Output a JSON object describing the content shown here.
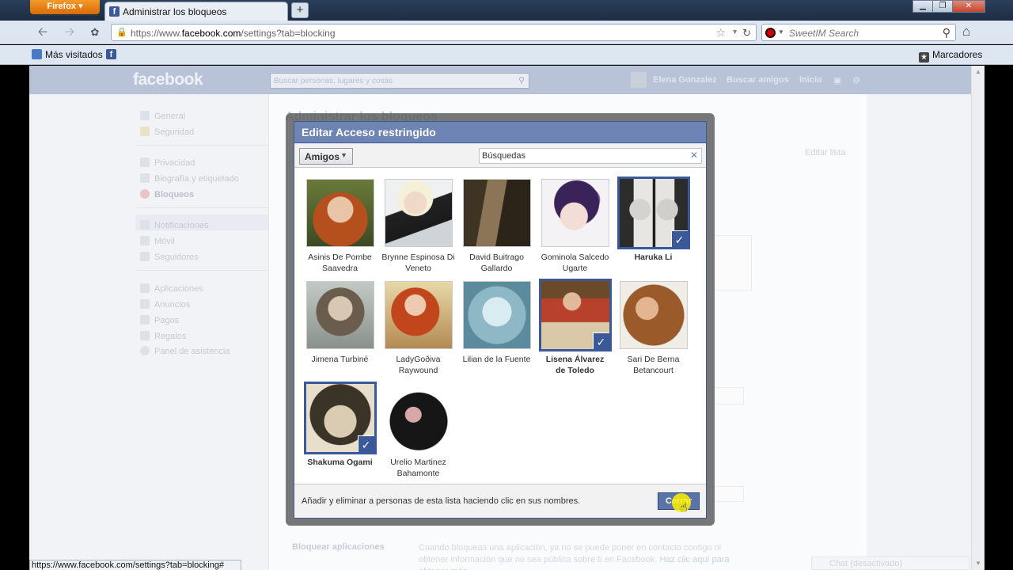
{
  "browser": {
    "menu_button": "Firefox",
    "tab_title": "Administrar los bloqueos",
    "new_tab": "+",
    "url_prefix": "https://www.",
    "url_domain": "facebook.com",
    "url_path": "/settings?tab=blocking",
    "search_placeholder": "SweetIM Search",
    "bookmarks_left": "Más visitados",
    "bookmarks_right": "Marcadores",
    "status_url": "https://www.facebook.com/settings?tab=blocking#"
  },
  "fb": {
    "logo": "facebook",
    "search_placeholder": "Buscar personas, lugares y cosas",
    "user_name": "Elena Gonzalez",
    "find_friends": "Buscar amigos",
    "home": "Inicio",
    "ghost_title": "Administrar los bloqueos",
    "ghost_edit": "Editar lista",
    "ghost_block_apps": "Bloquear aplicaciones",
    "ghost_block_apps_text": "Cuando bloqueas una aplicación, ya no se puede poner en contacto contigo ni obtener información que no sea pública sobre ti en Facebook.",
    "ghost_more": "Haz clic aquí para obtener más",
    "chat": "Chat (desactivado)"
  },
  "sidebar": {
    "items": [
      {
        "label": "General"
      },
      {
        "label": "Seguridad"
      },
      {
        "label": "Privacidad"
      },
      {
        "label": "Biografía y etiquetado"
      },
      {
        "label": "Bloqueos"
      },
      {
        "label": "Notificaciones"
      },
      {
        "label": "Móvil"
      },
      {
        "label": "Seguidores"
      },
      {
        "label": "Aplicaciones"
      },
      {
        "label": "Anuncios"
      },
      {
        "label": "Pagos"
      },
      {
        "label": "Regalos"
      },
      {
        "label": "Panel de asistencia"
      }
    ]
  },
  "dialog": {
    "title": "Editar Acceso restringido",
    "filter_label": "Amigos",
    "search_value": "Búsquedas",
    "footer_text": "Añadir y eliminar a personas de esta lista haciendo clic en sus nombres.",
    "close_label": "Cerrar",
    "friends": [
      {
        "line1": "Asinis De Pombe",
        "line2": "Saavedra",
        "selected": false
      },
      {
        "line1": "Brynne Espinosa Di",
        "line2": "Veneto",
        "selected": false
      },
      {
        "line1": "David Buitrago",
        "line2": "Gallardo",
        "selected": false
      },
      {
        "line1": "Gominola Salcedo",
        "line2": "Ugarte",
        "selected": false
      },
      {
        "line1": "Haruka Li",
        "line2": "",
        "selected": true
      },
      {
        "line1": "Jimena Turbiné",
        "line2": "",
        "selected": false
      },
      {
        "line1": "LadyGoðiva",
        "line2": "Raywound",
        "selected": false
      },
      {
        "line1": "Lilian de la Fuente",
        "line2": "",
        "selected": false
      },
      {
        "line1": "Lisena Álvarez",
        "line2": "de Toledo",
        "selected": true
      },
      {
        "line1": "Sari De Berna",
        "line2": "Betancourt",
        "selected": false
      },
      {
        "line1": "Shakuma Ogami",
        "line2": "",
        "selected": true
      },
      {
        "line1": "Urelio Martinez",
        "line2": "Bahamonte",
        "selected": false
      }
    ]
  }
}
